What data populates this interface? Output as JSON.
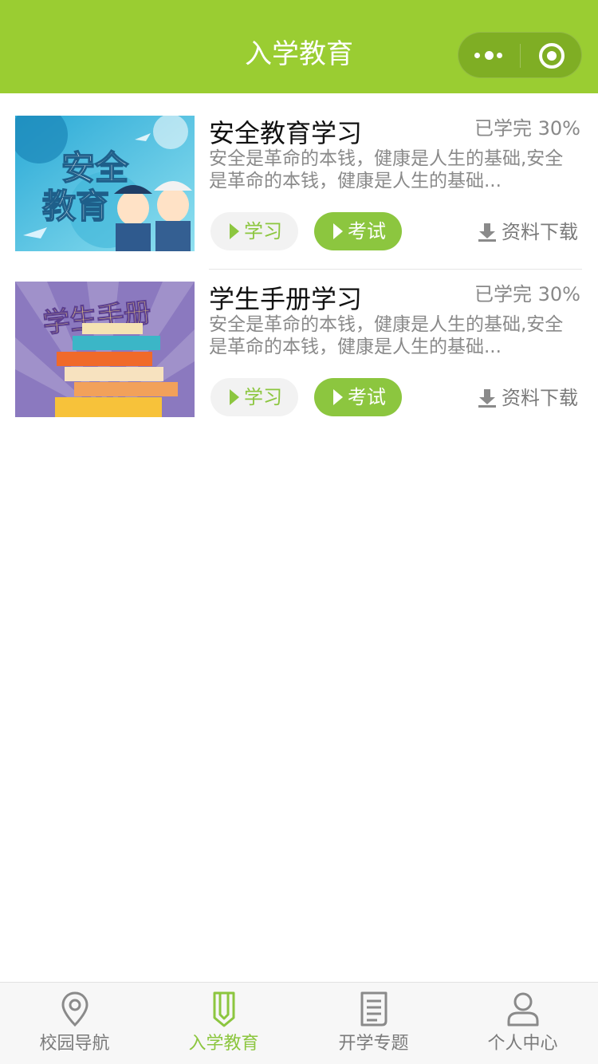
{
  "header": {
    "title": "入学教育",
    "menu_icon": "more-dots-icon",
    "close_icon": "target-circle-icon"
  },
  "items": [
    {
      "title": "安全教育学习",
      "progress": "已学完 30%",
      "description": "安全是革命的本钱，健康是人生的基础,安全是革命的本钱，健康是人生的基础...",
      "thumb_text_1": "安全",
      "thumb_text_2": "教育",
      "study_label": "学习",
      "exam_label": "考试",
      "download_label": "资料下载"
    },
    {
      "title": "学生手册学习",
      "progress": "已学完 30%",
      "description": "安全是革命的本钱，健康是人生的基础,安全是革命的本钱，健康是人生的基础...",
      "thumb_text_1": "学生手册",
      "study_label": "学习",
      "exam_label": "考试",
      "download_label": "资料下载"
    }
  ],
  "tabbar": {
    "tabs": [
      {
        "label": "校园导航",
        "icon": "location-pin-icon"
      },
      {
        "label": "入学教育",
        "icon": "pencil-icon",
        "active": true
      },
      {
        "label": "开学专题",
        "icon": "document-icon"
      },
      {
        "label": "个人中心",
        "icon": "user-icon"
      }
    ]
  },
  "colors": {
    "brand": "#9acd32",
    "accent": "#8cc63f",
    "text_secondary": "#8a8a8a"
  }
}
